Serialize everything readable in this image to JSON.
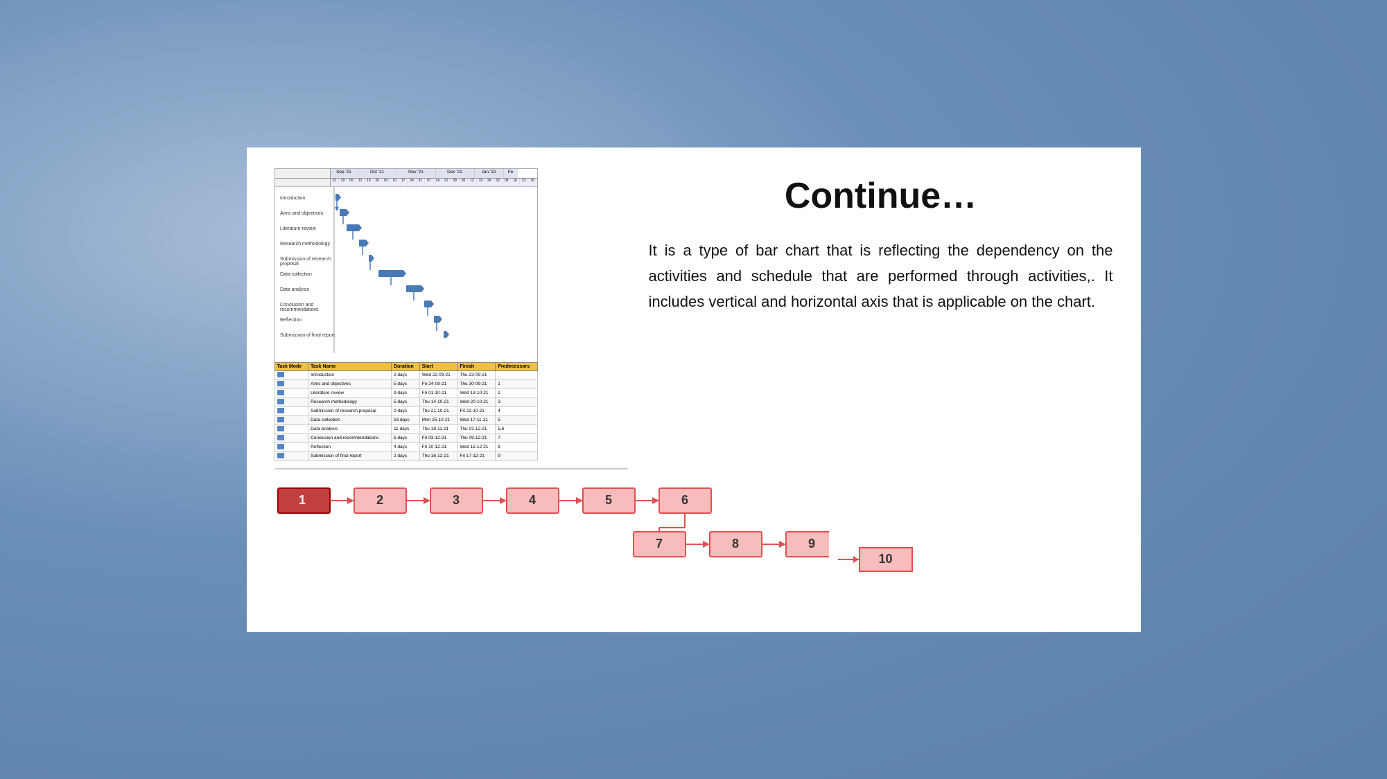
{
  "slide": {
    "title": "Continue…",
    "description": "It is a type of bar chart that is reflecting the dependency on the activities and schedule that are performed through activities,. It includes vertical and horizontal axis that is applicable on the chart.",
    "gantt": {
      "months": [
        "Sep '21",
        "Oct '21",
        "Nov '21",
        "Dec '21",
        "Jan '22",
        "Fe"
      ],
      "weeks": [
        "22",
        "29",
        "05",
        "12",
        "19",
        "26",
        "03",
        "10",
        "17",
        "24",
        "31",
        "07",
        "14",
        "21",
        "28",
        "05",
        "12",
        "19",
        "26",
        "02",
        "09",
        "16",
        "23",
        "30"
      ],
      "tasks": [
        {
          "name": "Introduction",
          "duration": "2 days",
          "start": "Wed 22-09-21",
          "finish": "Thu 23-09-21",
          "predecessors": ""
        },
        {
          "name": "Aims and objectives",
          "duration": "5 days",
          "start": "Fri 24-09-21",
          "finish": "Thu 30-09-21",
          "predecessors": "1"
        },
        {
          "name": "Literature review",
          "duration": "9 days",
          "start": "Fri 01-10-21",
          "finish": "Wed 13-10-21",
          "predecessors": "2"
        },
        {
          "name": "Research methodology",
          "duration": "5 days",
          "start": "Thu 14-10-21",
          "finish": "Wed 20-10-21",
          "predecessors": "3"
        },
        {
          "name": "Submission of research proposal",
          "duration": "2 days",
          "start": "Thu 21-10-21",
          "finish": "Fri 22-10-21",
          "predecessors": "4"
        },
        {
          "name": "Data collection",
          "duration": "18 days",
          "start": "Mon 25-10-21",
          "finish": "Wed 17-11-21",
          "predecessors": "5"
        },
        {
          "name": "Data analysis",
          "duration": "11 days",
          "start": "Thu 18-11-21",
          "finish": "Thu 02-12-21",
          "predecessors": "5,6"
        },
        {
          "name": "Conclusion and recommendations",
          "duration": "5 days",
          "start": "Fri 03-12-21",
          "finish": "Thu 09-12-21",
          "predecessors": "7"
        },
        {
          "name": "Reflection",
          "duration": "4 days",
          "start": "Fri 10-12-21",
          "finish": "Wed 15-12-21",
          "predecessors": "8"
        },
        {
          "name": "Submission of final report",
          "duration": "2 days",
          "start": "Thu 16-12-21",
          "finish": "Fri 17-12-21",
          "predecessors": "9"
        }
      ],
      "col_headers": [
        "Task Mode",
        "Task Name",
        "Duration",
        "Start",
        "Finish",
        "Predecessors"
      ]
    },
    "flow": {
      "top_nodes": [
        "1",
        "2",
        "3",
        "4",
        "5",
        "6"
      ],
      "bottom_nodes": [
        "7",
        "8",
        "9",
        "10"
      ]
    }
  }
}
